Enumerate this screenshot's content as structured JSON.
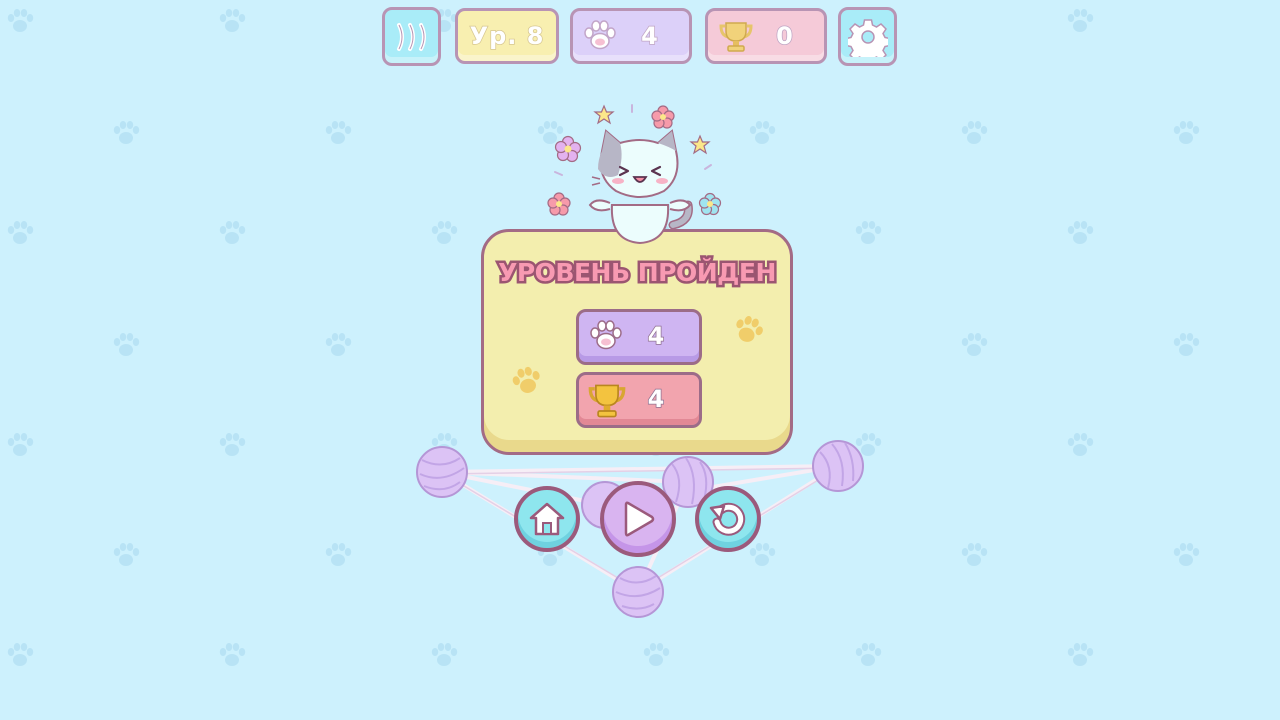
{
  "hud": {
    "menu_icon": "menu-bars-icon",
    "level_label": "Ур. 8",
    "paw_count": "4",
    "trophy_count": "0",
    "settings_icon": "gear-icon"
  },
  "result": {
    "title": "УРОВЕНЬ ПРОЙДЕН",
    "paws_earned": "4",
    "trophies_earned": "4"
  },
  "buttons": {
    "home_icon": "home-icon",
    "play_icon": "play-icon",
    "retry_icon": "retry-icon"
  },
  "colors": {
    "background": "#cdf1fd",
    "panel": "#f3eeae",
    "panel_border": "#a36b85",
    "title": "#f89ab2",
    "paw_badge": "#cfb5f2",
    "trophy_badge": "#f2a4ae",
    "round_button": "#8ee6ee",
    "play_button": "#d9b4f0"
  }
}
